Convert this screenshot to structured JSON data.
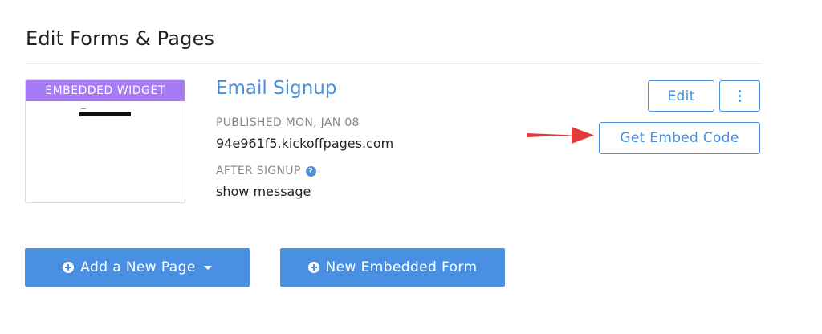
{
  "header": {
    "title": "Edit Forms & Pages"
  },
  "form_card": {
    "thumbnail_badge": "EMBEDDED WIDGET",
    "name": "Email Signup",
    "published": "PUBLISHED MON, JAN 08",
    "domain": "94e961f5.kickoffpages.com",
    "after_signup_label": "AFTER SIGNUP",
    "help_glyph": "?",
    "after_signup_value": "show message",
    "edit_label": "Edit",
    "embed_label": "Get Embed Code"
  },
  "actions": {
    "add_page_label": "Add a New Page",
    "new_form_label": "New Embedded Form"
  },
  "icons": {
    "help": "question-circle-icon",
    "more": "vertical-ellipsis-icon",
    "plus": "plus-circle-icon",
    "caret": "caret-down-icon",
    "arrow": "red-arrow-icon"
  },
  "colors": {
    "accent": "#4a90d9",
    "primary_button": "#4a90e2",
    "badge": "#a77bf3",
    "arrow": "#e03c3c"
  }
}
